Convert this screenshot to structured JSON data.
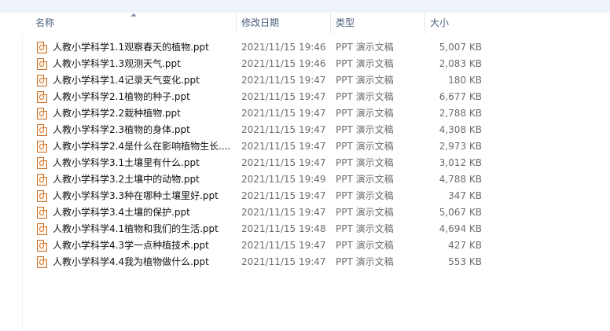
{
  "columns": {
    "name": "名称",
    "modified": "修改日期",
    "type": "类型",
    "size": "大小"
  },
  "files": [
    {
      "name": "人教小学科学1.1观察春天的植物.ppt",
      "modified": "2021/11/15 19:46",
      "type": "PPT 演示文稿",
      "size": "5,007 KB"
    },
    {
      "name": "人教小学科学1.3观测天气.ppt",
      "modified": "2021/11/15 19:46",
      "type": "PPT 演示文稿",
      "size": "2,083 KB"
    },
    {
      "name": "人教小学科学1.4记录天气变化.ppt",
      "modified": "2021/11/15 19:47",
      "type": "PPT 演示文稿",
      "size": "180 KB"
    },
    {
      "name": "人教小学科学2.1植物的种子.ppt",
      "modified": "2021/11/15 19:47",
      "type": "PPT 演示文稿",
      "size": "6,677 KB"
    },
    {
      "name": "人教小学科学2.2栽种植物.ppt",
      "modified": "2021/11/15 19:47",
      "type": "PPT 演示文稿",
      "size": "2,788 KB"
    },
    {
      "name": "人教小学科学2.3植物的身体.ppt",
      "modified": "2021/11/15 19:47",
      "type": "PPT 演示文稿",
      "size": "4,308 KB"
    },
    {
      "name": "人教小学科学2.4是什么在影响植物生长....",
      "modified": "2021/11/15 19:47",
      "type": "PPT 演示文稿",
      "size": "2,973 KB"
    },
    {
      "name": "人教小学科学3.1土壤里有什么.ppt",
      "modified": "2021/11/15 19:47",
      "type": "PPT 演示文稿",
      "size": "3,012 KB"
    },
    {
      "name": "人教小学科学3.2土壤中的动物.ppt",
      "modified": "2021/11/15 19:49",
      "type": "PPT 演示文稿",
      "size": "4,788 KB"
    },
    {
      "name": "人教小学科学3.3种在哪种土壤里好.ppt",
      "modified": "2021/11/15 19:47",
      "type": "PPT 演示文稿",
      "size": "347 KB"
    },
    {
      "name": "人教小学科学3.4土壤的保护.ppt",
      "modified": "2021/11/15 19:47",
      "type": "PPT 演示文稿",
      "size": "5,067 KB"
    },
    {
      "name": "人教小学科学4.1植物和我们的生活.ppt",
      "modified": "2021/11/15 19:48",
      "type": "PPT 演示文稿",
      "size": "4,694 KB"
    },
    {
      "name": "人教小学科学4.3学一点种植技术.ppt",
      "modified": "2021/11/15 19:47",
      "type": "PPT 演示文稿",
      "size": "427 KB"
    },
    {
      "name": "人教小学科学4.4我为植物做什么.ppt",
      "modified": "2021/11/15 19:47",
      "type": "PPT 演示文稿",
      "size": "553 KB"
    }
  ]
}
